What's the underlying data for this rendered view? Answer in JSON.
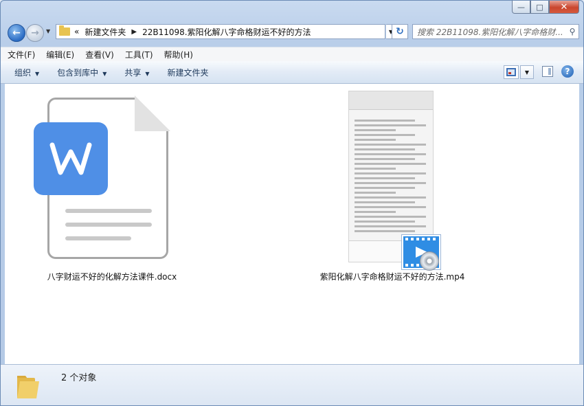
{
  "window": {
    "caption": {
      "minimize": "—",
      "maximize": "□",
      "close": "✕"
    }
  },
  "address": {
    "overflow": "«",
    "crumbs": [
      "新建文件夹",
      "22B11098.紫阳化解八字命格财运不好的方法"
    ],
    "search_placeholder": "搜索 22B11098.紫阳化解八字命格财..."
  },
  "menu": [
    "文件(F)",
    "编辑(E)",
    "查看(V)",
    "工具(T)",
    "帮助(H)"
  ],
  "toolbar": {
    "organize": "组织",
    "include_library": "包含到库中",
    "share": "共享",
    "new_folder": "新建文件夹"
  },
  "files": [
    {
      "name": "八字财运不好的化解方法课件.docx",
      "icon": "wps-writer-doc-icon"
    },
    {
      "name": "紫阳化解八字命格财运不好的方法.mp4",
      "icon": "video-thumbnail"
    }
  ],
  "status": {
    "count_text": "2 个对象"
  },
  "colors": {
    "wps_blue": "#4f8fe6",
    "window_frame": "#b9cee9",
    "content_bg": "#ffffff"
  }
}
